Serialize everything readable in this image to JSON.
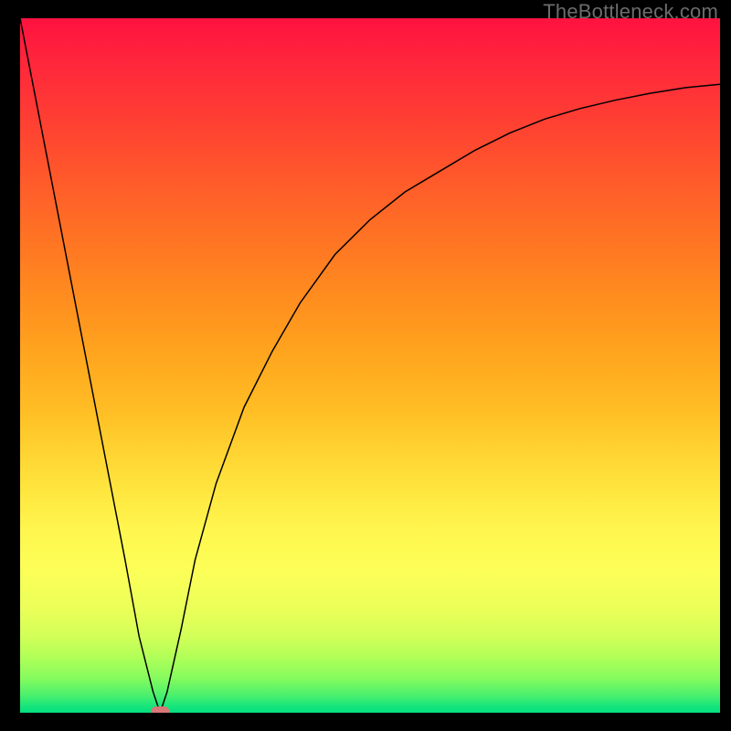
{
  "watermark": "TheBottleneck.com",
  "chart_data": {
    "type": "line",
    "title": "",
    "xlabel": "",
    "ylabel": "",
    "axes_visible": false,
    "legend_visible": false,
    "xlim": [
      0,
      100
    ],
    "ylim": [
      0,
      100
    ],
    "background_gradient": {
      "direction": "vertical",
      "stops": [
        {
          "pos": 0,
          "color": "#ff1240"
        },
        {
          "pos": 50,
          "color": "#ffbc24"
        },
        {
          "pos": 80,
          "color": "#fbff58"
        },
        {
          "pos": 100,
          "color": "#04df80"
        }
      ]
    },
    "series": [
      {
        "name": "bottleneck-curve",
        "color": "#000000",
        "x": [
          0,
          5,
          10,
          15,
          17,
          19,
          20,
          21,
          23,
          25,
          28,
          32,
          36,
          40,
          45,
          50,
          55,
          60,
          65,
          70,
          75,
          80,
          85,
          90,
          95,
          100
        ],
        "values": [
          100,
          74,
          48,
          22,
          11,
          3,
          0,
          3,
          12,
          22,
          33,
          44,
          52,
          59,
          66,
          71,
          75,
          78,
          81,
          83.5,
          85.5,
          87,
          88.2,
          89.2,
          90,
          90.5
        ]
      }
    ],
    "marker": {
      "name": "optimum-marker",
      "x": 20,
      "y": 0,
      "color": "#d97877",
      "shape": "rounded-rect"
    }
  }
}
